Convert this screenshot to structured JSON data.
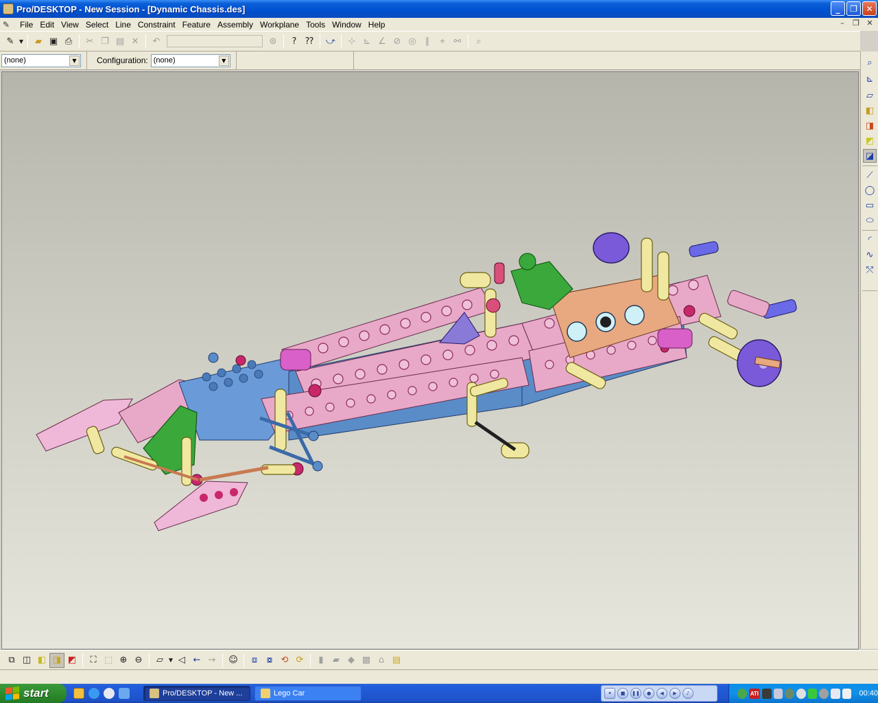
{
  "window": {
    "title": "Pro/DESKTOP - New Session - [Dynamic Chassis.des]",
    "buttons": {
      "minimize": "_",
      "restore": "❐",
      "close": "✕"
    }
  },
  "menu": {
    "items": [
      "File",
      "Edit",
      "View",
      "Select",
      "Line",
      "Constraint",
      "Feature",
      "Assembly",
      "Workplane",
      "Tools",
      "Window",
      "Help"
    ],
    "mdi_buttons": {
      "minimize": "–",
      "restore": "❐",
      "close": "✕"
    }
  },
  "configbar": {
    "combo1_value": "(none)",
    "config_label": "Configuration:",
    "config_value": "(none)",
    "arrow": "▼"
  },
  "toolbar": {
    "icons": [
      "undo-redo-icon",
      "open-icon",
      "save-icon",
      "print-icon",
      "cut-icon",
      "copy-icon",
      "paste-icon",
      "delete-icon",
      "undo-icon",
      "help-icon",
      "context-help-icon"
    ]
  },
  "taskbar": {
    "start_label": "start",
    "tasks": [
      {
        "label": "Pro/DESKTOP - New ...",
        "active": true
      },
      {
        "label": "Lego Car",
        "active": false
      }
    ],
    "clock": "00:40",
    "tray_badge": "ATI"
  },
  "colors": {
    "titlebar": "#0a5fd8",
    "chrome": "#ece9d8",
    "viewport_top": "#b6b5ab",
    "viewport_bottom": "#e6e6dc",
    "model_pink": "#e8a8c8",
    "model_magenta": "#c8286a",
    "model_blue": "#5a8cc8",
    "model_green": "#3aa83a",
    "model_yellow": "#e8e078",
    "model_purple": "#7a5ad8"
  }
}
